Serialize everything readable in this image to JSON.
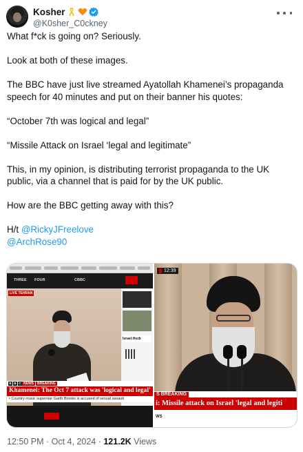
{
  "author": {
    "display_name": "Kosher",
    "handle": "@K0sher_C0ckney",
    "badges": [
      "yellow-ribbon-icon",
      "orange-heart-icon",
      "verified-badge-icon"
    ],
    "colors": {
      "verified": "#1d9bf0",
      "ribbon": "#f5c518",
      "heart": "#f4900c"
    }
  },
  "tweet": {
    "paragraphs": [
      "What f*ck is going on? Seriously.",
      "Look at both of these images.",
      "The BBC have just live streamed Ayatollah Khamenei’s propaganda speech for 40 minutes and put on their banner his quotes:",
      "“October 7th was logical and legal”",
      "“Missile Attack on Israel ‘legal and legitimate”",
      "This, in my opinion, is distributing terrorist propaganda to the UK public, via a channel that is paid for by the UK public.",
      "How are the BBC getting away with this?"
    ],
    "ht_prefix": "H/t ",
    "mentions": [
      "@RickyJFreelove",
      "@ArchRose90"
    ]
  },
  "media": {
    "left": {
      "channels": [
        "THREE",
        "FOUR",
        "CBBC"
      ],
      "live_label": "LIVE  TEHRAN",
      "side_headline": "Israel-Hezb",
      "bbc": [
        "B",
        "B",
        "C"
      ],
      "news_label": "NEWS",
      "breaking_label": "BREAKING",
      "headline": "Khamenei: The Oct 7 attack was 'logical and legal'",
      "ticker": "• Country music superstar Garth Brooks is accused of sexual assault"
    },
    "right": {
      "time": "12:39",
      "breaking_label": "S BREAKING",
      "headline": "i: Missile attack on Israel 'legal and legiti",
      "bottom_label": "WS"
    }
  },
  "meta": {
    "time": "12:50 PM",
    "separator": " · ",
    "date": "Oct 4, 2024",
    "views_count": "121.2K",
    "views_label": " Views"
  },
  "colors": {
    "link": "#1d9bf0",
    "text": "#0f1419",
    "muted": "#536471",
    "bbc_red": "#cc0000"
  }
}
